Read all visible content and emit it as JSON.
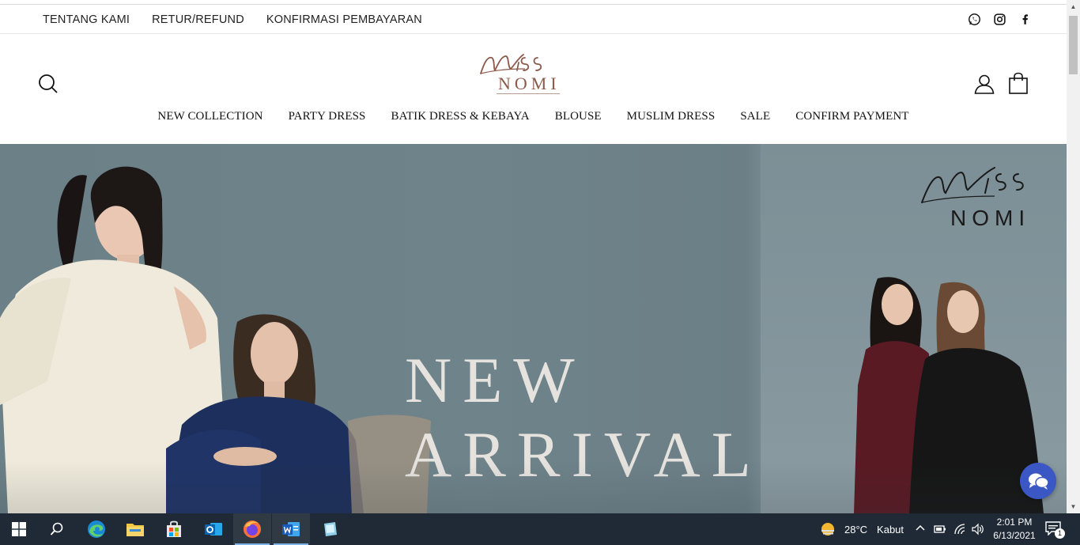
{
  "utility_bar": {
    "links": [
      "TENTANG KAMI",
      "RETUR/REFUND",
      "KONFIRMASI PEMBAYARAN"
    ],
    "social": [
      "whatsapp-icon",
      "instagram-icon",
      "facebook-icon"
    ]
  },
  "header": {
    "logo_script": "MiSS",
    "logo_text": "NOMI",
    "nav": [
      "NEW COLLECTION",
      "PARTY DRESS",
      "BATIK DRESS & KEBAYA",
      "BLOUSE",
      "MUSLIM DRESS",
      "SALE",
      "CONFIRM PAYMENT"
    ]
  },
  "hero": {
    "line1": "NEW",
    "line2": "ARRIVAL",
    "logo_script": "MiSS",
    "logo_text": "NOMI"
  },
  "taskbar": {
    "weather_temp": "28°C",
    "weather_text": "Kabut",
    "time": "2:01 PM",
    "date": "6/13/2021",
    "notification_count": "1"
  },
  "colors": {
    "hero_bg": "#6f838b",
    "taskbar": "#1f2a36",
    "chat": "#3b57c4",
    "logo_brown": "#8b5a4a"
  }
}
